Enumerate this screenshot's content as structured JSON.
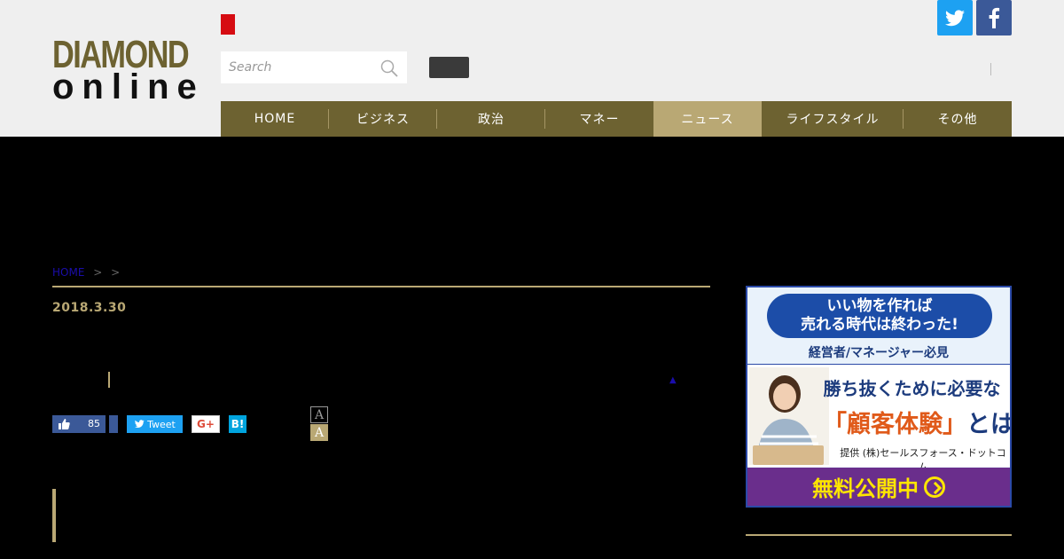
{
  "header": {
    "logo_line1": "DIAMOND",
    "logo_line2": "online",
    "search_placeholder": "Search",
    "nav": [
      {
        "label": "HOME",
        "width": 122,
        "active": false
      },
      {
        "label": "ビジネス",
        "width": 122,
        "active": false
      },
      {
        "label": "政治",
        "width": 122,
        "active": false
      },
      {
        "label": "マネー",
        "width": 122,
        "active": false
      },
      {
        "label": "ニュース",
        "width": 122,
        "active": false
      },
      {
        "label": "ライフスタイル",
        "width": 160,
        "active": false
      },
      {
        "label": "その他",
        "width": 122,
        "active": false
      }
    ],
    "nav_active_index": 4
  },
  "article": {
    "breadcrumb_home": "HOME",
    "breadcrumb_sep": ">",
    "date": "2018.3.30",
    "like_count": "85",
    "tweet_label": "Tweet",
    "gplus_label": "G+",
    "hatena_label": "B!",
    "font_small": "A",
    "font_large": "A"
  },
  "ad": {
    "headline_line1": "いい物を作れば",
    "headline_line2": "売れる時代は終わった!",
    "target": "経営者/マネージャー必見",
    "title_line1": "勝ち抜くために必要な",
    "title_line2": "「顧客体験」",
    "title_line2_suffix": "とは",
    "provider": "提供 (株)セールスフォース・ドットコム",
    "cta": "無料公開中"
  },
  "colors": {
    "brand_gold": "#6d6231",
    "accent_gold": "#b9a874",
    "twitter": "#1da1f2",
    "facebook": "#3b5998"
  }
}
